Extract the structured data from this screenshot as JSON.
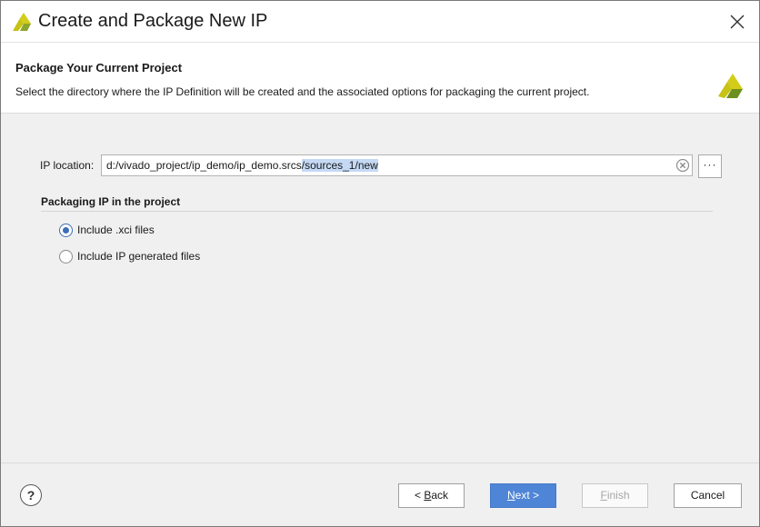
{
  "window": {
    "title": "Create and Package New IP",
    "icon": "vivado-logo-icon",
    "close_icon": "close-icon"
  },
  "header": {
    "title": "Package Your Current Project",
    "description": "Select the directory where the IP Definition will be created and the associated options for packaging the current project."
  },
  "ip_location": {
    "label": "IP location:",
    "value_unselected": "d:/vivado_project/ip_demo/ip_demo.srcs",
    "value_selected": "/sources_1/new",
    "browse_label": "···"
  },
  "packaging": {
    "group_title": "Packaging IP in the project",
    "options": [
      {
        "label": "Include .xci files",
        "checked": true
      },
      {
        "label": "Include IP generated files",
        "checked": false
      }
    ]
  },
  "footer": {
    "help_label": "?",
    "back": {
      "prefix": "< ",
      "mnemonic": "B",
      "rest": "ack"
    },
    "next": {
      "mnemonic": "N",
      "rest": "ext >"
    },
    "finish": {
      "mnemonic": "F",
      "rest": "inish",
      "disabled": true
    },
    "cancel": "Cancel"
  },
  "colors": {
    "accent": "#4f85d6",
    "selection": "#c5d9f4",
    "logo_yellow": "#c7c214",
    "logo_green": "#6d8f1f"
  }
}
